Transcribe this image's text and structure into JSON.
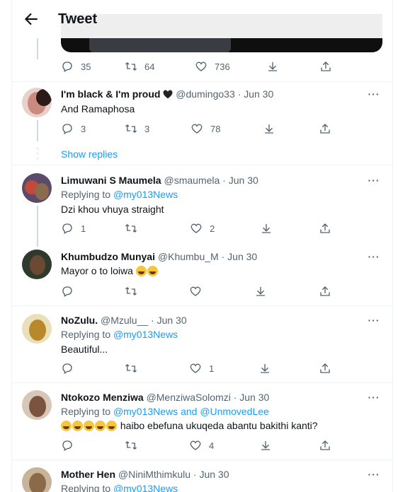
{
  "header": {
    "title": "Tweet"
  },
  "top_tweet_actions": {
    "replies": "35",
    "retweets": "64",
    "likes": "736"
  },
  "tweets": [
    {
      "display_name": "I'm black & I'm proud",
      "handle": "@dumingo33",
      "date": "Jun 30",
      "replying_to": "",
      "text": "And Ramaphosa",
      "replies": "3",
      "retweets": "3",
      "likes": "78"
    },
    {
      "display_name": "Limuwani S Maumela",
      "handle": "@smaumela",
      "date": "Jun 30",
      "replying_prefix": "Replying to",
      "replying_to": "@my013News",
      "text": "Dzi khou vhuya straight",
      "replies": "1",
      "retweets": "",
      "likes": "2"
    },
    {
      "display_name": "Khumbudzo Munyai",
      "handle": "@Khumbu_M",
      "date": "Jun 30",
      "text": "Mayor o to loiwa",
      "replies": "",
      "retweets": "",
      "likes": ""
    },
    {
      "display_name": "NoZulu.",
      "handle": "@Mzulu__",
      "date": "Jun 30",
      "replying_prefix": "Replying to",
      "replying_to": "@my013News",
      "text": "Beautiful...",
      "replies": "",
      "retweets": "",
      "likes": "1"
    },
    {
      "display_name": "Ntokozo Menziwa",
      "handle": "@MenziwaSolomzi",
      "date": "Jun 30",
      "replying_prefix": "Replying to",
      "replying_to": "@my013News and @UnmovedLee",
      "text": "haibo ebefuna ukuqeda abantu bakithi kanti?",
      "replies": "",
      "retweets": "",
      "likes": "4"
    },
    {
      "display_name": "Mother Hen",
      "handle": "@NiniMthimkulu",
      "date": "Jun 30",
      "replying_prefix": "Replying to",
      "replying_to": "@my013News"
    }
  ],
  "show_replies": "Show replies",
  "meta_separator": "·",
  "more_label": "···",
  "colors": {
    "accent": "#1d9bf0",
    "secondary_text": "#536471",
    "divider": "#eff3f4",
    "thread_line": "#cfd9de"
  }
}
